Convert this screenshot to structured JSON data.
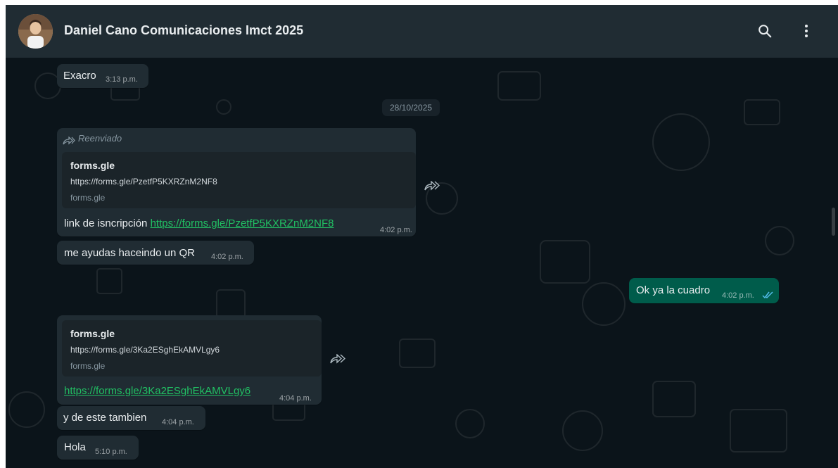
{
  "chat": {
    "title": "Daniel Cano Comunicaciones Imct 2025"
  },
  "messages": {
    "m1": {
      "text": "Exacro",
      "time": "3:13 p.m."
    },
    "date_chip": "28/10/2025",
    "m2": {
      "forwarded_label": "Reenviado",
      "preview": {
        "title": "forms.gle",
        "url": "https://forms.gle/PzetfP5KXRZnM2NF8",
        "domain": "forms.gle"
      },
      "text_prefix": "link de isncripción",
      "link": "https://forms.gle/PzetfP5KXRZnM2NF8",
      "time": "4:02 p.m."
    },
    "m3": {
      "text": "me ayudas haceindo un QR",
      "time": "4:02 p.m."
    },
    "m4": {
      "text": "Ok ya la cuadro",
      "time": "4:02 p.m.",
      "status": "read"
    },
    "m5": {
      "preview": {
        "title": "forms.gle",
        "url": "https://forms.gle/3Ka2ESghEkAMVLgy6",
        "domain": "forms.gle"
      },
      "link": "https://forms.gle/3Ka2ESghEkAMVLgy6",
      "time": "4:04 p.m."
    },
    "m6": {
      "text": "y de este tambien",
      "time": "4:04 p.m."
    },
    "m7": {
      "text": "Hola",
      "time": "5:10 p.m."
    }
  },
  "icons": {
    "search": "search-icon",
    "menu": "more-vertical-icon",
    "forward": "forward-icon",
    "read": "double-check-icon"
  },
  "colors": {
    "header_bg": "#202c33",
    "chat_bg": "#0b141a",
    "incoming_bubble": "#202c33",
    "outgoing_bubble": "#005c4b",
    "link": "#21c063",
    "read_ticks": "#53bdeb"
  }
}
